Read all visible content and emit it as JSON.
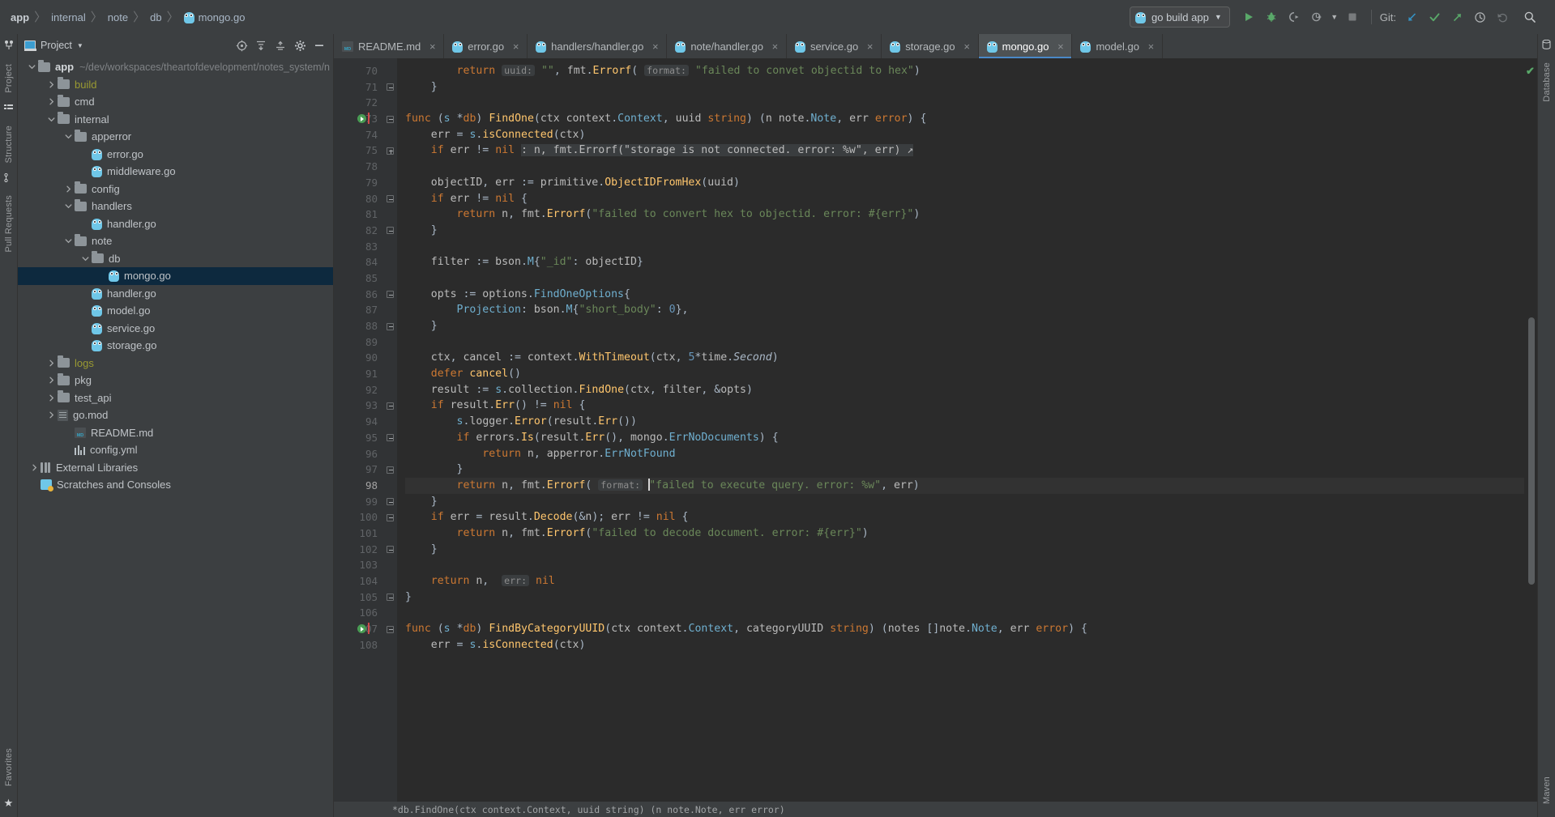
{
  "breadcrumb": {
    "items": [
      {
        "label": "app",
        "bold": true,
        "icon": null
      },
      {
        "label": "internal",
        "bold": false,
        "icon": null
      },
      {
        "label": "note",
        "bold": false,
        "icon": null
      },
      {
        "label": "db",
        "bold": false,
        "icon": null
      },
      {
        "label": "mongo.go",
        "bold": false,
        "icon": "go-gopher-icon"
      }
    ],
    "separator": "〉"
  },
  "toolbar": {
    "run_config": "go build app",
    "run_config_icon": "go-gopher-icon",
    "dropdown_icon": "chevron-down-icon",
    "run_label": "Run",
    "debug_label": "Debug",
    "coverage_label": "Run with Coverage",
    "profile_label": "Profile",
    "profile_dropdown": "chevron-down-icon",
    "stop_label": "Stop",
    "git_label": "Git:",
    "git_update_label": "Update Project",
    "git_commit_label": "Commit",
    "git_push_label": "Push",
    "git_history_label": "History",
    "git_rollback_label": "Rollback",
    "search_label": "Search Everywhere",
    "colors": {
      "run_green": "#59a869",
      "git_blue": "#3592c4",
      "git_green": "#59a869",
      "accent": "#4a88c7"
    }
  },
  "stripes": {
    "left": [
      "Project",
      "Structure",
      "Pull Requests",
      "Favorites"
    ],
    "right": [
      "Database",
      "Maven"
    ]
  },
  "project_panel": {
    "title": "Project",
    "title_dropdown": "chevron-down-icon",
    "actions": [
      "locate-icon",
      "expand-all-icon",
      "collapse-all-icon",
      "settings-gear-icon",
      "hide-icon"
    ],
    "tree": [
      {
        "depth": 0,
        "arrow": "down",
        "icon": "folder",
        "label": "app",
        "bold": true,
        "path": "~/dev/workspaces/theartofdevelopment/notes_system/n",
        "selected": false
      },
      {
        "depth": 1,
        "arrow": "right",
        "icon": "folder",
        "label": "build",
        "excluded": true,
        "selected": false
      },
      {
        "depth": 1,
        "arrow": "right",
        "icon": "folder",
        "label": "cmd",
        "selected": false
      },
      {
        "depth": 1,
        "arrow": "down",
        "icon": "folder",
        "label": "internal",
        "selected": false
      },
      {
        "depth": 2,
        "arrow": "down",
        "icon": "folder",
        "label": "apperror",
        "selected": false
      },
      {
        "depth": 3,
        "arrow": "none",
        "icon": "go",
        "label": "error.go",
        "selected": false
      },
      {
        "depth": 3,
        "arrow": "none",
        "icon": "go",
        "label": "middleware.go",
        "selected": false
      },
      {
        "depth": 2,
        "arrow": "right",
        "icon": "folder",
        "label": "config",
        "selected": false
      },
      {
        "depth": 2,
        "arrow": "down",
        "icon": "folder",
        "label": "handlers",
        "selected": false
      },
      {
        "depth": 3,
        "arrow": "none",
        "icon": "go",
        "label": "handler.go",
        "selected": false
      },
      {
        "depth": 2,
        "arrow": "down",
        "icon": "folder",
        "label": "note",
        "selected": false
      },
      {
        "depth": 3,
        "arrow": "down",
        "icon": "folder",
        "label": "db",
        "selected": false
      },
      {
        "depth": 4,
        "arrow": "none",
        "icon": "go",
        "label": "mongo.go",
        "selected": true
      },
      {
        "depth": 3,
        "arrow": "none",
        "icon": "go",
        "label": "handler.go",
        "selected": false
      },
      {
        "depth": 3,
        "arrow": "none",
        "icon": "go",
        "label": "model.go",
        "selected": false
      },
      {
        "depth": 3,
        "arrow": "none",
        "icon": "go",
        "label": "service.go",
        "selected": false
      },
      {
        "depth": 3,
        "arrow": "none",
        "icon": "go",
        "label": "storage.go",
        "selected": false
      },
      {
        "depth": 1,
        "arrow": "right",
        "icon": "folder",
        "label": "logs",
        "excluded": true,
        "selected": false
      },
      {
        "depth": 1,
        "arrow": "right",
        "icon": "folder",
        "label": "pkg",
        "selected": false
      },
      {
        "depth": 1,
        "arrow": "right",
        "icon": "folder",
        "label": "test_api",
        "selected": false
      },
      {
        "depth": 1,
        "arrow": "right",
        "icon": "gomod",
        "label": "go.mod",
        "selected": false
      },
      {
        "depth": 2,
        "arrow": "none",
        "icon": "md",
        "label": "README.md",
        "selected": false
      },
      {
        "depth": 2,
        "arrow": "none",
        "icon": "yml",
        "label": "config.yml",
        "selected": false
      },
      {
        "depth": 0,
        "arrow": "right",
        "icon": "lib",
        "label": "External Libraries",
        "selected": false
      },
      {
        "depth": 0,
        "arrow": "none",
        "icon": "scratch",
        "label": "Scratches and Consoles",
        "selected": false
      }
    ]
  },
  "editor": {
    "tabs": [
      {
        "label": "README.md",
        "icon": "markdown-icon",
        "active": false
      },
      {
        "label": "error.go",
        "icon": "go-gopher-icon",
        "active": false
      },
      {
        "label": "handlers/handler.go",
        "icon": "go-gopher-icon",
        "active": false
      },
      {
        "label": "note/handler.go",
        "icon": "go-gopher-icon",
        "active": false
      },
      {
        "label": "service.go",
        "icon": "go-gopher-icon",
        "active": false
      },
      {
        "label": "storage.go",
        "icon": "go-gopher-icon",
        "active": false
      },
      {
        "label": "mongo.go",
        "icon": "go-gopher-icon",
        "active": true
      },
      {
        "label": "model.go",
        "icon": "go-gopher-icon",
        "active": false
      }
    ],
    "close_glyph": "×",
    "first_line_number": 70,
    "cursor_line": 98,
    "status_text": "*db.FindOne(ctx context.Context, uuid string) (n note.Note, err error)",
    "inspection_ok": "✔",
    "lines": [
      {
        "num": "70",
        "fold": null,
        "run": false,
        "text_html": "        <span class=\"kw\">return</span> <span class=\"hint\">uuid:</span> <span class=\"str\">\"\"</span><span class=\"pl\">,</span> fmt<span class=\"pl\">.</span><span class=\"fn\">Errorf</span><span class=\"pl\">(</span> <span class=\"hint\">format:</span> <span class=\"str\">\"failed to convet objectid to hex\"</span><span class=\"pl\">)</span>"
      },
      {
        "num": "71",
        "fold": "minus",
        "run": false,
        "text_html": "    <span class=\"pl\">}</span>"
      },
      {
        "num": "72",
        "fold": null,
        "run": false,
        "text_html": ""
      },
      {
        "num": "73",
        "fold": "minus",
        "run": true,
        "text_html": "<span class=\"kw\">func</span> <span class=\"pl\">(</span><span class=\"sfield\">s</span> <span class=\"pl\">*</span><span class=\"kw\">db</span><span class=\"pl\">)</span> <span class=\"fn\">FindOne</span><span class=\"pl\">(</span>ctx context<span class=\"pl\">.</span><span class=\"sfield\">Context</span><span class=\"pl\">,</span> uuid <span class=\"kw\">string</span><span class=\"pl\">)</span> <span class=\"pl\">(</span>n note<span class=\"pl\">.</span><span class=\"sfield\">Note</span><span class=\"pl\">,</span> err <span class=\"kw\">error</span><span class=\"pl\">)</span> <span class=\"pl\">{</span>"
      },
      {
        "num": "74",
        "fold": null,
        "run": false,
        "text_html": "    err <span class=\"pl\">=</span> <span class=\"sfield\">s</span><span class=\"pl\">.</span><span class=\"fn\">isConnected</span><span class=\"pl\">(</span>ctx<span class=\"pl\">)</span>"
      },
      {
        "num": "75",
        "fold": "plus",
        "run": false,
        "text_html": "    <span class=\"kw\">if</span> err <span class=\"pl\">!=</span> <span class=\"kw\">nil</span> <span class=\"foldedbg\">: n, fmt.Errorf(\"storage is not connected. error: %w\", err) ↗</span>"
      },
      {
        "num": "78",
        "fold": null,
        "run": false,
        "text_html": ""
      },
      {
        "num": "79",
        "fold": null,
        "run": false,
        "text_html": "    objectID<span class=\"pl\">,</span> err <span class=\"pl\">:=</span> primitive<span class=\"pl\">.</span><span class=\"fn\">ObjectIDFromHex</span><span class=\"pl\">(</span>uuid<span class=\"pl\">)</span>"
      },
      {
        "num": "80",
        "fold": "minus",
        "run": false,
        "text_html": "    <span class=\"kw\">if</span> err <span class=\"pl\">!=</span> <span class=\"kw\">nil</span> <span class=\"pl\">{</span>"
      },
      {
        "num": "81",
        "fold": null,
        "run": false,
        "text_html": "        <span class=\"kw\">return</span> n<span class=\"pl\">,</span> fmt<span class=\"pl\">.</span><span class=\"fn\">Errorf</span><span class=\"pl\">(</span><span class=\"str\">\"failed to convert hex to objectid. error: #{err}\"</span><span class=\"pl\">)</span>"
      },
      {
        "num": "82",
        "fold": "minus",
        "run": false,
        "text_html": "    <span class=\"pl\">}</span>"
      },
      {
        "num": "83",
        "fold": null,
        "run": false,
        "text_html": ""
      },
      {
        "num": "84",
        "fold": null,
        "run": false,
        "text_html": "    filter <span class=\"pl\">:=</span> bson<span class=\"pl\">.</span><span class=\"sfield\">M</span><span class=\"pl\">{</span><span class=\"str\">\"_id\"</span><span class=\"pl\">:</span> objectID<span class=\"pl\">}</span>"
      },
      {
        "num": "85",
        "fold": null,
        "run": false,
        "text_html": ""
      },
      {
        "num": "86",
        "fold": "minus",
        "run": false,
        "text_html": "    opts <span class=\"pl\">:=</span> options<span class=\"pl\">.</span><span class=\"sfield\">FindOneOptions</span><span class=\"pl\">{</span>"
      },
      {
        "num": "87",
        "fold": null,
        "run": false,
        "text_html": "        <span class=\"sfield\">Projection</span><span class=\"pl\">:</span> bson<span class=\"pl\">.</span><span class=\"sfield\">M</span><span class=\"pl\">{</span><span class=\"str\">\"short_body\"</span><span class=\"pl\">:</span> <span class=\"num\">0</span><span class=\"pl\">},</span>"
      },
      {
        "num": "88",
        "fold": "minus",
        "run": false,
        "text_html": "    <span class=\"pl\">}</span>"
      },
      {
        "num": "89",
        "fold": null,
        "run": false,
        "text_html": ""
      },
      {
        "num": "90",
        "fold": null,
        "run": false,
        "text_html": "    ctx<span class=\"pl\">,</span> cancel <span class=\"pl\">:=</span> context<span class=\"pl\">.</span><span class=\"fn\">WithTimeout</span><span class=\"pl\">(</span>ctx<span class=\"pl\">,</span> <span class=\"num\">5</span><span class=\"pl\">*</span>time<span class=\"pl\">.</span><span class=\"itl\">Second</span><span class=\"pl\">)</span>"
      },
      {
        "num": "91",
        "fold": null,
        "run": false,
        "text_html": "    <span class=\"kw\">defer</span> <span class=\"fn\">cancel</span><span class=\"pl\">()</span>"
      },
      {
        "num": "92",
        "fold": null,
        "run": false,
        "text_html": "    result <span class=\"pl\">:=</span> <span class=\"sfield\">s</span><span class=\"pl\">.</span>collection<span class=\"pl\">.</span><span class=\"fn\">FindOne</span><span class=\"pl\">(</span>ctx<span class=\"pl\">,</span> filter<span class=\"pl\">,</span> <span class=\"pl\">&amp;</span>opts<span class=\"pl\">)</span>"
      },
      {
        "num": "93",
        "fold": "minus",
        "run": false,
        "text_html": "    <span class=\"kw\">if</span> result<span class=\"pl\">.</span><span class=\"fn\">Err</span><span class=\"pl\">()</span> <span class=\"pl\">!=</span> <span class=\"kw\">nil</span> <span class=\"pl\">{</span>"
      },
      {
        "num": "94",
        "fold": null,
        "run": false,
        "text_html": "        <span class=\"sfield\">s</span><span class=\"pl\">.</span>logger<span class=\"pl\">.</span><span class=\"fn\">Error</span><span class=\"pl\">(</span>result<span class=\"pl\">.</span><span class=\"fn\">Err</span><span class=\"pl\">())</span>"
      },
      {
        "num": "95",
        "fold": "minus",
        "run": false,
        "text_html": "        <span class=\"kw\">if</span> errors<span class=\"pl\">.</span><span class=\"fn\">Is</span><span class=\"pl\">(</span>result<span class=\"pl\">.</span><span class=\"fn\">Err</span><span class=\"pl\">(),</span> mongo<span class=\"pl\">.</span><span class=\"sfield\">ErrNoDocuments</span><span class=\"pl\">)</span> <span class=\"pl\">{</span>"
      },
      {
        "num": "96",
        "fold": null,
        "run": false,
        "text_html": "            <span class=\"kw\">return</span> n<span class=\"pl\">,</span> apperror<span class=\"pl\">.</span><span class=\"sfield\">ErrNotFound</span>"
      },
      {
        "num": "97",
        "fold": "minus",
        "run": false,
        "text_html": "        <span class=\"pl\">}</span>"
      },
      {
        "num": "98",
        "fold": null,
        "run": false,
        "cursor": true,
        "text_html": "        <span class=\"kw\">return</span> n<span class=\"pl\">,</span> fmt<span class=\"pl\">.</span><span class=\"fn\">Errorf</span><span class=\"pl\">(</span> <span class=\"hint\">format:</span> <span class=\"caret\"></span><span class=\"str\">\"failed to execute query. error: %w\"</span><span class=\"pl\">,</span> err<span class=\"pl\">)</span>"
      },
      {
        "num": "99",
        "fold": "minus",
        "run": false,
        "text_html": "    <span class=\"pl\">}</span>"
      },
      {
        "num": "100",
        "fold": "minus",
        "run": false,
        "text_html": "    <span class=\"kw\">if</span> err <span class=\"pl\">=</span> result<span class=\"pl\">.</span><span class=\"fn\">Decode</span><span class=\"pl\">(&amp;</span>n<span class=\"pl\">);</span> err <span class=\"pl\">!=</span> <span class=\"kw\">nil</span> <span class=\"pl\">{</span>"
      },
      {
        "num": "101",
        "fold": null,
        "run": false,
        "text_html": "        <span class=\"kw\">return</span> n<span class=\"pl\">,</span> fmt<span class=\"pl\">.</span><span class=\"fn\">Errorf</span><span class=\"pl\">(</span><span class=\"str\">\"failed to decode document. error: #{err}\"</span><span class=\"pl\">)</span>"
      },
      {
        "num": "102",
        "fold": "minus",
        "run": false,
        "text_html": "    <span class=\"pl\">}</span>"
      },
      {
        "num": "103",
        "fold": null,
        "run": false,
        "text_html": ""
      },
      {
        "num": "104",
        "fold": null,
        "run": false,
        "text_html": "    <span class=\"kw\">return</span> n<span class=\"pl\">,</span>  <span class=\"hint\">err:</span> <span class=\"kw\">nil</span>"
      },
      {
        "num": "105",
        "fold": "minus",
        "run": false,
        "text_html": "<span class=\"pl\">}</span>"
      },
      {
        "num": "106",
        "fold": null,
        "run": false,
        "text_html": ""
      },
      {
        "num": "107",
        "fold": "minus",
        "run": true,
        "text_html": "<span class=\"kw\">func</span> <span class=\"pl\">(</span><span class=\"sfield\">s</span> <span class=\"pl\">*</span><span class=\"kw\">db</span><span class=\"pl\">)</span> <span class=\"fn\">FindByCategoryUUID</span><span class=\"pl\">(</span>ctx context<span class=\"pl\">.</span><span class=\"sfield\">Context</span><span class=\"pl\">,</span> categoryUUID <span class=\"kw\">string</span><span class=\"pl\">)</span> <span class=\"pl\">(</span>notes <span class=\"pl\">[]</span>note<span class=\"pl\">.</span><span class=\"sfield\">Note</span><span class=\"pl\">,</span> err <span class=\"kw\">error</span><span class=\"pl\">)</span> <span class=\"pl\">{</span>"
      },
      {
        "num": "108",
        "fold": null,
        "run": false,
        "text_html": "    err <span class=\"pl\">=</span> <span class=\"sfield\">s</span><span class=\"pl\">.</span><span class=\"fn\">isConnected</span><span class=\"pl\">(</span>ctx<span class=\"pl\">)</span>"
      }
    ]
  }
}
